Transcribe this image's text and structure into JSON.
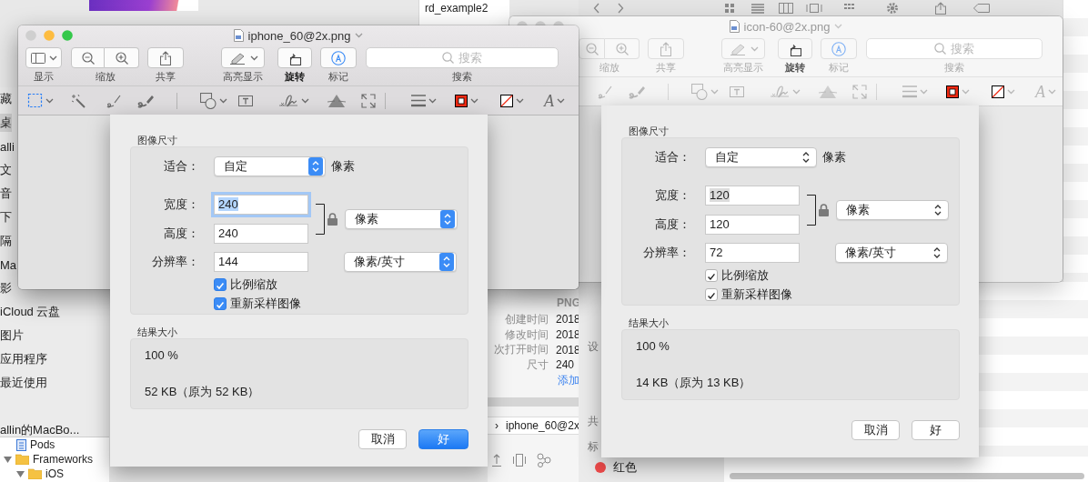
{
  "finder": {
    "file_names": [
      "rd_example2"
    ],
    "sidebar": [
      {
        "items": [
          {
            "label": "藏",
            "selected": false
          },
          {
            "label": "桌",
            "selected": true
          },
          {
            "label": "alli",
            "selected": false
          },
          {
            "label": "文",
            "selected": false
          },
          {
            "label": "音",
            "selected": false
          },
          {
            "label": "下",
            "selected": false
          },
          {
            "label": "隔",
            "selected": false
          },
          {
            "label": "Ma",
            "selected": false
          },
          {
            "label": "影",
            "selected": false
          },
          {
            "label": "iCloud 云盘",
            "selected": false
          },
          {
            "label": "图片",
            "selected": false
          },
          {
            "label": "应用程序",
            "selected": false
          },
          {
            "label": "最近使用",
            "selected": false
          }
        ]
      },
      {
        "items": [
          {
            "label": "allin的MacBo...",
            "selected": false
          }
        ]
      }
    ],
    "tree": [
      {
        "label": "Pods",
        "kind": "project"
      },
      {
        "label": "Frameworks",
        "kind": "folder",
        "expanded": true,
        "children": [
          {
            "label": "iOS",
            "kind": "folder",
            "expanded": true
          }
        ]
      }
    ],
    "info": {
      "kind": "PNG",
      "rows": [
        {
          "label": "创建时间",
          "value": "2018"
        },
        {
          "label": "修改时间",
          "value": "2018"
        },
        {
          "label": "次打开时间",
          "value": "2018"
        },
        {
          "label": "尺寸",
          "value": "240"
        }
      ],
      "link": "添加"
    },
    "path_bar": {
      "separator": "›",
      "file": "iphone_60@2x"
    },
    "inspector": {
      "headings": [
        "设",
        "共",
        "标"
      ],
      "tags": [
        {
          "label": "红色",
          "color": "#f04b4b"
        }
      ]
    }
  },
  "windows": [
    {
      "title": "iphone_60@2x.png",
      "active": true,
      "toolbar": [
        {
          "kind": "display",
          "label": "显示",
          "emphasized": false
        },
        {
          "kind": "zoom",
          "label": "缩放",
          "emphasized": false
        },
        {
          "kind": "share",
          "label": "共享",
          "emphasized": false
        },
        {
          "kind": "highlight",
          "label": "高亮显示",
          "emphasized": false
        },
        {
          "kind": "rotate",
          "label": "旋转",
          "emphasized": true
        },
        {
          "kind": "markup",
          "label": "标记",
          "emphasized": false
        }
      ],
      "search": {
        "placeholder": "搜索",
        "label": "搜索"
      },
      "font_glyph": "A",
      "sheet": {
        "size_title": "图像尺寸",
        "fit": {
          "label": "适合：",
          "value": "自定",
          "unit": "像素"
        },
        "width": {
          "label": "宽度：",
          "value": "240",
          "focused": true
        },
        "height": {
          "label": "高度：",
          "value": "240",
          "focused": false
        },
        "size_unit": "像素",
        "resolution": {
          "label": "分辨率：",
          "value": "144",
          "unit": "像素/英寸",
          "focused": false
        },
        "checkboxes": [
          {
            "label": "比例缩放",
            "checked": true
          },
          {
            "label": "重新采样图像",
            "checked": true
          }
        ],
        "result_title": "结果大小",
        "result_percent": "100 %",
        "result_size": "52 KB（原为 52 KB）",
        "buttons": [
          {
            "label": "取消",
            "default": false
          },
          {
            "label": "好",
            "default": true
          }
        ]
      }
    },
    {
      "title": "icon-60@2x.png",
      "active": false,
      "toolbar": [
        {
          "kind": "zoom",
          "label": "缩放",
          "emphasized": false
        },
        {
          "kind": "share",
          "label": "共享",
          "emphasized": false
        },
        {
          "kind": "highlight",
          "label": "高亮显示",
          "emphasized": false
        },
        {
          "kind": "rotate",
          "label": "旋转",
          "emphasized": true
        },
        {
          "kind": "markup",
          "label": "标记",
          "emphasized": false
        }
      ],
      "search": {
        "placeholder": "搜索",
        "label": "搜索"
      },
      "font_glyph": "A",
      "sheet": {
        "size_title": "图像尺寸",
        "fit": {
          "label": "适合：",
          "value": "自定",
          "unit": "像素"
        },
        "width": {
          "label": "宽度：",
          "value": "120",
          "focused": true
        },
        "height": {
          "label": "高度：",
          "value": "120",
          "focused": false
        },
        "size_unit": "像素",
        "resolution": {
          "label": "分辨率：",
          "value": "72",
          "unit": "像素/英寸",
          "focused": false
        },
        "checkboxes": [
          {
            "label": "比例缩放",
            "checked": true
          },
          {
            "label": "重新采样图像",
            "checked": true
          }
        ],
        "result_title": "结果大小",
        "result_percent": "100 %",
        "result_size": "14 KB（原为 13 KB）",
        "buttons": [
          {
            "label": "取消",
            "default": false
          },
          {
            "label": "好",
            "default": false
          }
        ]
      }
    }
  ]
}
